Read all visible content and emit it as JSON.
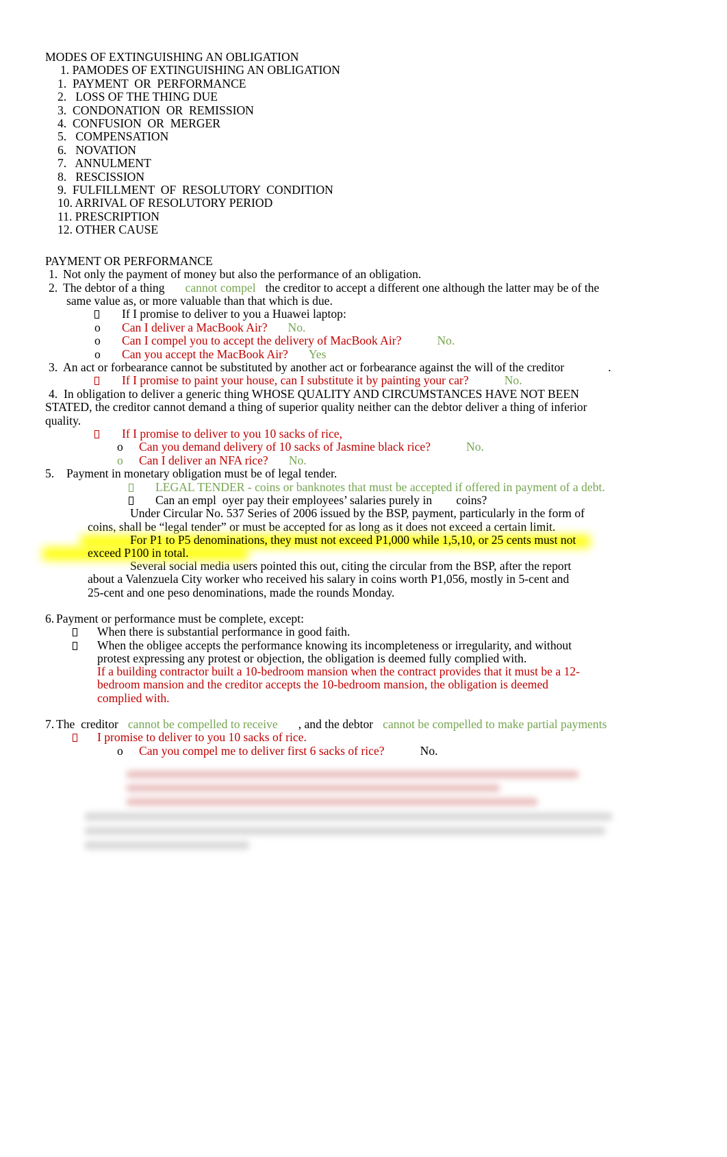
{
  "document": {
    "title": "MODES OF EXTINGUISHING AN OBLIGATION",
    "subtitle": "1. PAMODES OF EXTINGUISHING AN OBLIGATION",
    "modes": [
      "1.  PAYMENT  OR  PERFORMANCE",
      "2.   LOSS OF THE THING DUE",
      "3.  CONDONATION  OR  REMISSION",
      "4.  CONFUSION  OR  MERGER",
      "5.   COMPENSATION",
      "6.   NOVATION",
      "7.   ANNULMENT",
      "8.   RESCISSION",
      "9.  FULFILLMENT  OF  RESOLUTORY  CONDITION",
      "10. ARRIVAL OF RESOLUTORY PERIOD",
      "11. PRESCRIPTION",
      "12. OTHER CAUSE"
    ],
    "section_heading": "PAYMENT OR PERFORMANCE",
    "item1": {
      "marker": "1.",
      "text": "Not only the payment of money but also the performance of an obligation."
    },
    "item2": {
      "marker": "2.",
      "lead": "The debtor of a thing",
      "emphasis": "cannot compel",
      "rest": "the creditor to accept a different one although the latter may be of the",
      "line2": "same value as, or more valuable than that which is due.",
      "bullet_text": "If I promise to deliver to you a Huawei laptop:",
      "qas": [
        {
          "marker": "o",
          "question": "Can I deliver a MacBook Air?",
          "answer": "No."
        },
        {
          "marker": "o",
          "question": "Can I compel you to accept the delivery of MacBook Air?",
          "answer": "No."
        },
        {
          "marker": "o",
          "question": "Can you accept the MacBook Air?",
          "answer": "Yes"
        }
      ]
    },
    "item3": {
      "marker": "3.",
      "text": "An act or forbearance cannot be substituted by another act or forbearance against the will of the creditor",
      "trailing_period": ".",
      "question": "If I promise to paint your house, can I substitute it by painting your car?",
      "answer": "No."
    },
    "item4": {
      "marker": "4.",
      "line1": "In obligation to deliver a generic thing WHOSE QUALITY AND CIRCUMSTANCES HAVE NOT BEEN",
      "line2": "STATED, the creditor cannot demand a thing of superior quality neither can the debtor deliver a thing of inferior",
      "line3": "quality.",
      "bullet_text": "If I promise to deliver to you 10 sacks of rice,",
      "qas": [
        {
          "marker": "o",
          "marker_color": "black",
          "question": "Can you demand delivery of 10 sacks of Jasmine black rice?",
          "answer": "No."
        },
        {
          "marker": "o",
          "marker_color": "green",
          "question": "Can I deliver an NFA rice?",
          "answer": "No."
        }
      ]
    },
    "item5": {
      "marker": "5.",
      "text": "Payment in monetary obligation must be of legal tender.",
      "legal_tender_term": "LEGAL TENDER",
      "legal_tender_def": " - coins or banknotes that must be accepted if offered in payment of a debt.",
      "question": "Can an empl  oyer pay their employees’ salaries purely in        coins?",
      "para1_line1": "Under Circular No. 537 Series of 2006 issued by the BSP, payment, particularly in the form of",
      "para1_line2": "coins, shall be “legal tender” or must be accepted for as long as it does not exceed a certain limit.",
      "highlight_line1": "For P1 to P5 denominations, they must not exceed P1,000 while 1,5,10, or 25 cents must not",
      "highlight_line2": "exceed P100 in total.",
      "para2_line1": "Several social media users pointed this out, citing the circular from the BSP, after the report",
      "para2_line2": "about a Valenzuela City worker who received his salary in coins worth P1,056, mostly in 5-cent and",
      "para2_line3": "25-cent and one peso denominations, made the rounds Monday."
    },
    "item6": {
      "marker": "6.",
      "text": "Payment or performance must be complete, except:",
      "bullets": [
        {
          "line1": "When there is substantial performance in good faith."
        },
        {
          "line1": "When the obligee accepts the performance knowing its incompleteness or irregularity, and without",
          "line2": "protest expressing any protest or objection, the obligation is deemed fully complied with."
        }
      ],
      "example_line1": "If a building contractor built a 10-bedroom mansion when the contract provides that it must be a 12-",
      "example_line2": "bedroom mansion and the creditor accepts the 10-bedroom mansion, the obligation is deemed",
      "example_line3": "complied with."
    },
    "item7": {
      "marker": "7.",
      "lead": "The  creditor",
      "emphasis1": "cannot be compelled to receive",
      "middle": ", and the debtor",
      "emphasis2": "cannot be compelled to make partial payments",
      "bullet_text": "I promise to deliver to you 10 sacks of rice.",
      "qa": {
        "marker": "o",
        "question": "Can you compel me to deliver first 6 sacks of rice?",
        "answer": "No."
      }
    },
    "obscured_region": {
      "note": "Text below is blurred and illegible in the source image."
    }
  },
  "colors": {
    "red": "#c00000",
    "green": "#76a551",
    "black": "#000000",
    "highlight": "#ffff00"
  }
}
